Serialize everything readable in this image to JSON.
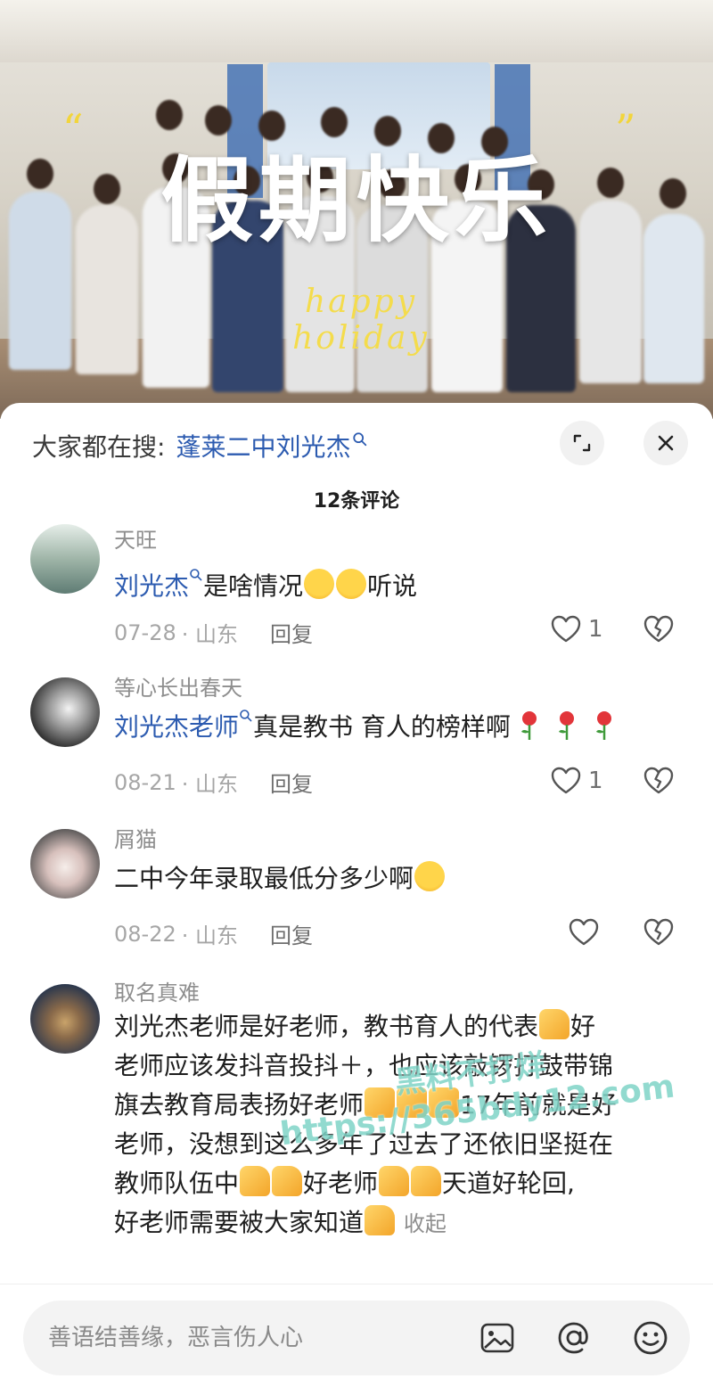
{
  "video": {
    "title": "假期快乐",
    "subtitle": "happy holiday"
  },
  "sheet": {
    "search_prefix": "大家都在搜:",
    "search_term": "蓬莱二中刘光杰",
    "comment_count": "12条评论"
  },
  "comments": [
    {
      "name": "天旺",
      "mention": "刘光杰",
      "text": "是啥情况",
      "text_after": "听说",
      "date": "07-28",
      "location": "· 山东",
      "reply": "回复",
      "likes": "1"
    },
    {
      "name": "等心长出春天",
      "mention": "刘光杰老师",
      "text": "真是教书 育人的榜样啊",
      "date": "08-21",
      "location": "· 山东",
      "reply": "回复",
      "likes": "1"
    },
    {
      "name": "屑猫",
      "text": "二中今年录取最低分多少啊",
      "date": "08-22",
      "location": "· 山东",
      "reply": "回复",
      "likes": ""
    },
    {
      "name": "取名真难",
      "line1": "刘光杰老师是好老师，教书育人的代表",
      "line1_end": "好",
      "line2": "老师应该发抖音投抖＋，也应该敲锣打鼓带锦",
      "line3": "旗去教育局表扬好老师",
      "line3_end": "17年前就是好",
      "line4": "老师，没想到这么多年了过去了还依旧坚挺在",
      "line5_a": "教师队伍中",
      "line5_b": "好老师",
      "line5_c": "天道好轮回,",
      "line6": "好老师需要被大家知道",
      "collapse": "收起"
    }
  ],
  "watermark": {
    "line1": "黑料不打烊",
    "line2": "https://365bdy12.com"
  },
  "input": {
    "placeholder": "善语结善缘，恶言伤人心"
  },
  "icons": [
    "search-icon",
    "expand-icon",
    "close-icon",
    "heart-icon",
    "broken-heart-icon",
    "image-icon",
    "at-icon",
    "smiley-icon"
  ],
  "colors": {
    "link_blue": "#2c5bb0",
    "title_yellow": "#f4dc4c",
    "watermark_teal": "#7fd4c7"
  }
}
